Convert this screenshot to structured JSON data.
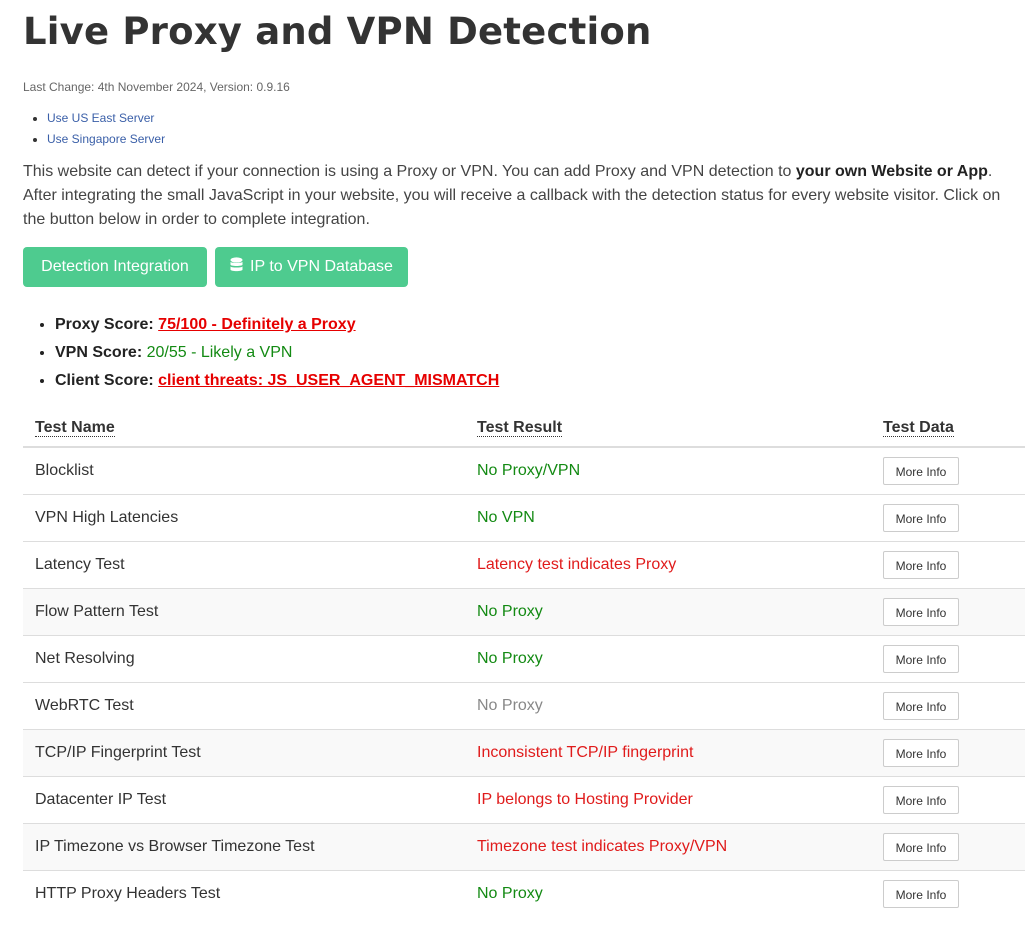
{
  "title": "Live Proxy and VPN Detection",
  "last_change": "Last Change: 4th November 2024, Version: 0.9.16",
  "servers": [
    "Use US East Server",
    "Use Singapore Server"
  ],
  "intro": {
    "part1": "This website can detect if your connection is using a Proxy or VPN. You can add Proxy and VPN detection to ",
    "bold": "your own Website or App",
    "part2": ". After integrating the small JavaScript in your website, you will receive a callback with the detection status for every website visitor. Click on the button below in order to complete integration."
  },
  "buttons": {
    "integration": "Detection Integration",
    "database": "IP to VPN Database",
    "database_icon": "database-icon"
  },
  "scores": {
    "proxy_label": "Proxy Score:",
    "proxy_value": "75/100 - Definitely a Proxy",
    "vpn_label": "VPN Score:",
    "vpn_value": "20/55 - Likely a VPN",
    "client_label": "Client Score:",
    "client_value": "client threats: JS_USER_AGENT_MISMATCH"
  },
  "colors": {
    "accent_button": "#4ecb8f",
    "positive": "#138a13",
    "negative": "#e01b1b",
    "neutral": "#888888",
    "link": "#3a5fa8"
  },
  "table": {
    "headers": [
      "Test Name",
      "Test Result",
      "Test Data"
    ],
    "more_info_label": "More Info",
    "rows": [
      {
        "name": "Blocklist",
        "result": "No Proxy/VPN",
        "status": "green"
      },
      {
        "name": "VPN High Latencies",
        "result": "No VPN",
        "status": "green"
      },
      {
        "name": "Latency Test",
        "result": "Latency test indicates Proxy",
        "status": "red"
      },
      {
        "name": "Flow Pattern Test",
        "result": "No Proxy",
        "status": "green"
      },
      {
        "name": "Net Resolving",
        "result": "No Proxy",
        "status": "green"
      },
      {
        "name": "WebRTC Test",
        "result": "No Proxy",
        "status": "gray"
      },
      {
        "name": "TCP/IP Fingerprint Test",
        "result": "Inconsistent TCP/IP fingerprint",
        "status": "red"
      },
      {
        "name": "Datacenter IP Test",
        "result": "IP belongs to Hosting Provider",
        "status": "red"
      },
      {
        "name": "IP Timezone vs Browser Timezone Test",
        "result": "Timezone test indicates Proxy/VPN",
        "status": "red"
      },
      {
        "name": "HTTP Proxy Headers Test",
        "result": "No Proxy",
        "status": "green"
      }
    ]
  }
}
